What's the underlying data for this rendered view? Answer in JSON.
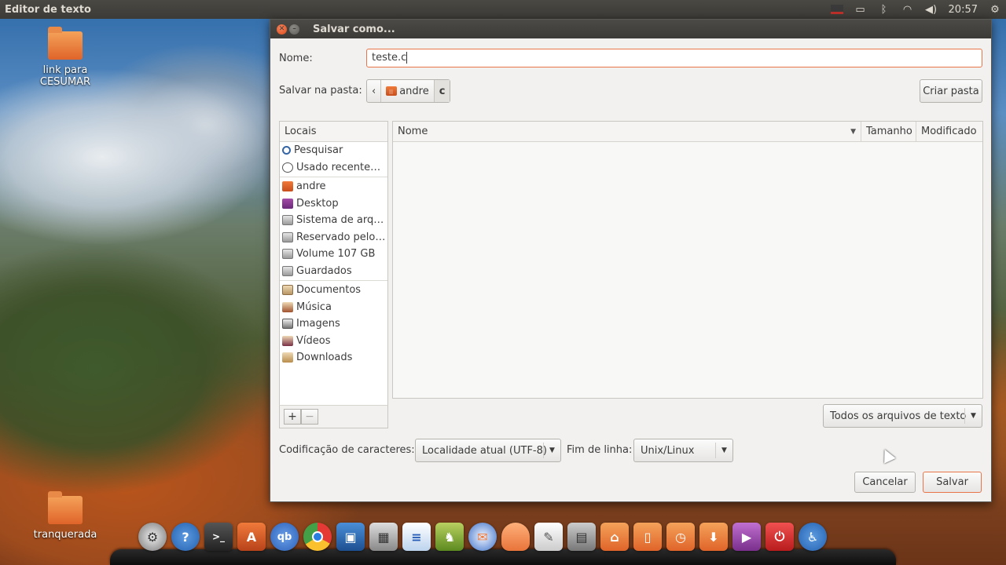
{
  "top_panel": {
    "app_title": "Editor de texto",
    "clock": "20:57"
  },
  "desktop": {
    "icons": [
      {
        "label": "link para CESUMAR"
      },
      {
        "label": "tranquerada"
      }
    ]
  },
  "dialog": {
    "title": "Salvar como...",
    "name_label": "Nome:",
    "name_value": "teste.c",
    "folder_label": "Salvar na pasta:",
    "path_segments": [
      "‹",
      "andre",
      "c"
    ],
    "create_folder": "Criar pasta",
    "places_header": "Locais",
    "places": [
      {
        "label": "Pesquisar",
        "icon": "search-icon"
      },
      {
        "label": "Usado recente…",
        "icon": "recent-icon"
      },
      {
        "label": "andre",
        "icon": "home-icon"
      },
      {
        "label": "Desktop",
        "icon": "desktop-icon"
      },
      {
        "label": "Sistema de arq…",
        "icon": "drive-icon"
      },
      {
        "label": "Reservado pelo…",
        "icon": "drive-icon"
      },
      {
        "label": "Volume 107 GB",
        "icon": "drive-icon"
      },
      {
        "label": "Guardados",
        "icon": "drive-icon"
      },
      {
        "label": "Documentos",
        "icon": "folder-icon"
      },
      {
        "label": "Música",
        "icon": "music-folder-icon"
      },
      {
        "label": "Imagens",
        "icon": "pictures-folder-icon"
      },
      {
        "label": "Vídeos",
        "icon": "videos-folder-icon"
      },
      {
        "label": "Downloads",
        "icon": "downloads-folder-icon"
      }
    ],
    "add_place": "+",
    "remove_place": "−",
    "columns": {
      "name": "Nome",
      "size": "Tamanho",
      "modified": "Modificado"
    },
    "filter": "Todos os arquivos de texto",
    "encoding_label": "Codificação de caracteres:",
    "encoding_value": "Localidade atual (UTF-8)",
    "line_end_label": "Fim de linha:",
    "line_end_value": "Unix/Linux",
    "cancel": "Cancelar",
    "save": "Salvar"
  },
  "colors": {
    "panel": "#3c3b37",
    "accent": "#e8744a",
    "dialog_bg": "#f2f1f0"
  }
}
